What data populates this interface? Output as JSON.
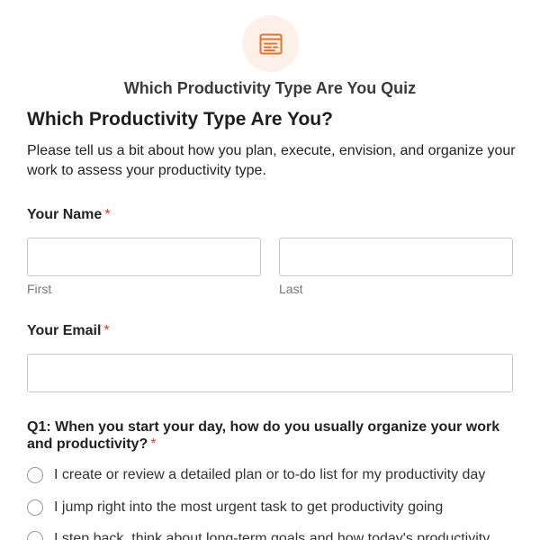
{
  "app": {
    "title": "Which Productivity Type Are You Quiz",
    "logo_icon": "form-list-icon",
    "accent_color": "#e8722a"
  },
  "form": {
    "heading": "Which Productivity Type Are You?",
    "description": "Please tell us a bit about how you plan, execute, envision, and organize your work to assess your productivity type.",
    "required_mark": "*",
    "name": {
      "label": "Your Name",
      "first": {
        "value": "",
        "sublabel": "First"
      },
      "last": {
        "value": "",
        "sublabel": "Last"
      }
    },
    "email": {
      "label": "Your Email",
      "value": ""
    },
    "q1": {
      "question": "Q1: When you start your day, how do you usually organize your work and productivity?",
      "options": [
        "I create or review a detailed plan or to-do list for my productivity day",
        "I jump right into the most urgent task to get productivity going",
        "I step back, think about long-term goals and how today's productivity"
      ]
    }
  }
}
